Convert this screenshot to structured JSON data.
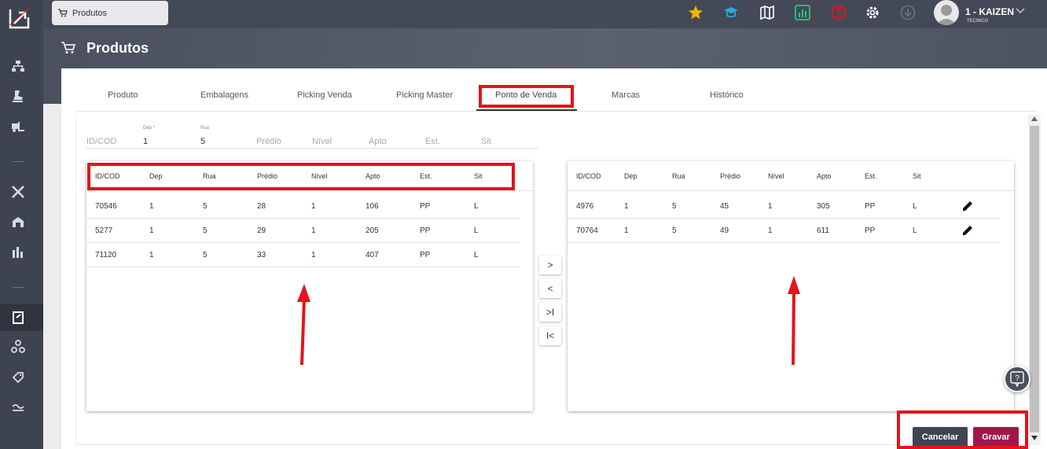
{
  "app": {
    "tab_title": "Produtos",
    "page_title": "Produtos",
    "user": {
      "name": "1 - KAIZEN",
      "role": "TECNICO"
    }
  },
  "colors": {
    "highlight": "#e4141b",
    "save": "#a1174c",
    "cancel": "#3f4451",
    "sidebar": "#3d4350"
  },
  "topbar_icons": [
    "star-icon",
    "graduation-cap-icon",
    "map-icon",
    "dashboard-icon",
    "help-circle-icon",
    "settings-icon",
    "download-icon"
  ],
  "sidebar_icons": [
    "sitemap-icon",
    "stamp-icon",
    "forklift-icon",
    "tools-icon",
    "warehouse-icon",
    "chart-bars-icon",
    "document-edit-icon",
    "boxes-icon",
    "tag-icon",
    "flow-icon"
  ],
  "tabs": [
    {
      "label": "Produto"
    },
    {
      "label": "Embalagens"
    },
    {
      "label": "Picking Venda"
    },
    {
      "label": "Picking Master"
    },
    {
      "label": "Ponto de Venda"
    },
    {
      "label": "Marcas"
    },
    {
      "label": "Histórico"
    }
  ],
  "filters": {
    "idcod": {
      "placeholder": "ID/COD"
    },
    "dep": {
      "label": "Dep *",
      "value": "1"
    },
    "rua": {
      "label": "Rua",
      "value": "5"
    },
    "predio": {
      "placeholder": "Prédio"
    },
    "nivel": {
      "placeholder": "Nível"
    },
    "apto": {
      "placeholder": "Apto"
    },
    "est": {
      "placeholder": "Est."
    },
    "sit": {
      "placeholder": "Sit"
    }
  },
  "columns": [
    "ID/COD",
    "Dep",
    "Rua",
    "Prédio",
    "Nível",
    "Apto",
    "Est.",
    "Sit"
  ],
  "left_rows": [
    [
      "70546",
      "1",
      "5",
      "28",
      "1",
      "106",
      "PP",
      "L"
    ],
    [
      "5277",
      "1",
      "5",
      "29",
      "1",
      "205",
      "PP",
      "L"
    ],
    [
      "71120",
      "1",
      "5",
      "33",
      "1",
      "407",
      "PP",
      "L"
    ]
  ],
  "right_rows": [
    [
      "4976",
      "1",
      "5",
      "45",
      "1",
      "305",
      "PP",
      "L"
    ],
    [
      "70764",
      "1",
      "5",
      "49",
      "1",
      "611",
      "PP",
      "L"
    ]
  ],
  "move_buttons": [
    ">",
    "<",
    ">I",
    "I<"
  ],
  "actions": {
    "cancel": "Cancelar",
    "save": "Gravar"
  }
}
